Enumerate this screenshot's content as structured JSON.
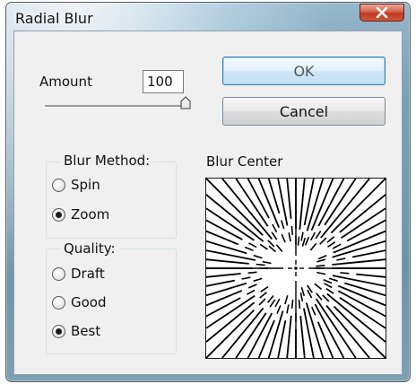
{
  "window": {
    "title": "Radial Blur",
    "close_icon": "close-x-icon"
  },
  "amount": {
    "label": "Amount",
    "value": "100",
    "slider_fraction": 1.0
  },
  "buttons": {
    "ok_label": "OK",
    "cancel_label": "Cancel"
  },
  "blur_method": {
    "title": "Blur Method:",
    "options": [
      {
        "label": "Spin",
        "checked": false
      },
      {
        "label": "Zoom",
        "checked": true
      }
    ]
  },
  "quality": {
    "title": "Quality:",
    "options": [
      {
        "label": "Draft",
        "checked": false
      },
      {
        "label": "Good",
        "checked": false
      },
      {
        "label": "Best",
        "checked": true
      }
    ]
  },
  "blur_center": {
    "label": "Blur Center"
  }
}
